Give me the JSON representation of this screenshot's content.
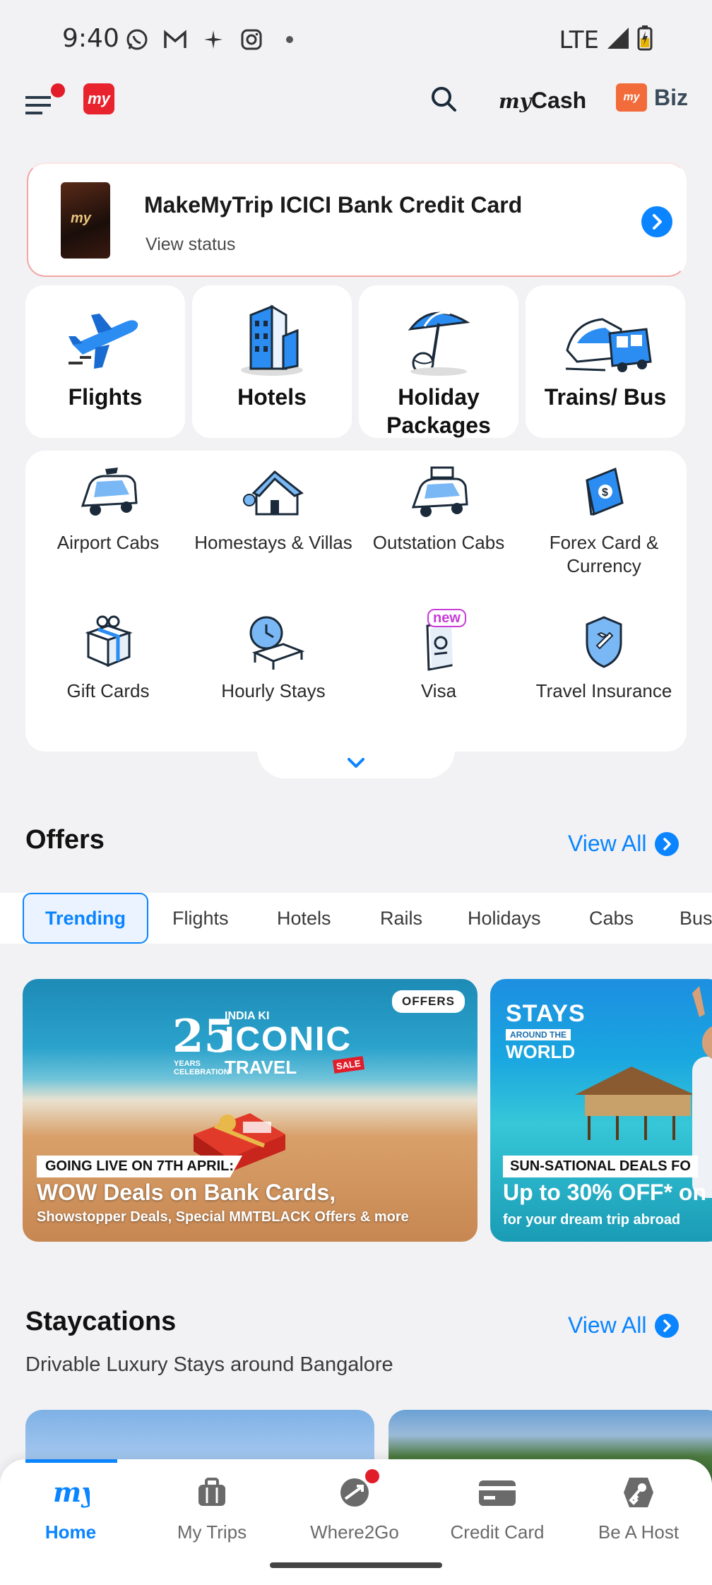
{
  "status_bar": {
    "time": "9:40",
    "network": "LTE"
  },
  "header": {
    "mycash_prefix": "my",
    "mycash_label": "Cash",
    "biz_label": "Biz",
    "biz_badge": "my",
    "logo": "my"
  },
  "credit_card": {
    "title": "MakeMyTrip ICICI Bank Credit Card",
    "subtitle": "View status"
  },
  "primary_tiles": [
    {
      "label": "Flights",
      "icon": "airplane-icon"
    },
    {
      "label": "Hotels",
      "icon": "hotel-building-icon"
    },
    {
      "label": "Holiday Packages",
      "icon": "beach-umbrella-icon"
    },
    {
      "label": "Trains/ Bus",
      "icon": "train-bus-icon"
    }
  ],
  "secondary_services": [
    {
      "label": "Airport Cabs",
      "icon": "airport-cab-icon"
    },
    {
      "label": "Homestays & Villas",
      "icon": "homestay-icon"
    },
    {
      "label": "Outstation Cabs",
      "icon": "outstation-cab-icon"
    },
    {
      "label": "Forex Card & Currency",
      "icon": "forex-card-icon"
    },
    {
      "label": "Gift Cards",
      "icon": "gift-card-icon"
    },
    {
      "label": "Hourly Stays",
      "icon": "hourly-stay-icon"
    },
    {
      "label": "Visa",
      "icon": "visa-passport-icon",
      "badge": "new"
    },
    {
      "label": "Travel Insurance",
      "icon": "travel-insurance-icon"
    }
  ],
  "offers": {
    "title": "Offers",
    "view_all": "View All",
    "tabs": [
      "Trending",
      "Flights",
      "Hotels",
      "Rails",
      "Holidays",
      "Cabs",
      "Bus"
    ],
    "active_tab": "Trending",
    "cards": [
      {
        "tag": "OFFERS",
        "brand_kicker": "INDIA KI",
        "brand_number": "25",
        "brand_years": "YEARS CELEBRATION",
        "brand_big": "ICONIC",
        "brand_sub": "TRAVEL",
        "brand_badge": "SALE",
        "kicker": "GOING LIVE ON 7TH APRIL:",
        "headline": "WOW Deals on Bank Cards,",
        "description": "Showstopper Deals, Special MMTBLACK Offers & more"
      },
      {
        "brand_big": "STAYS",
        "brand_small": "AROUND THE",
        "brand_world": "WORLD",
        "kicker": "SUN-SATIONAL DEALS FO",
        "headline": "Up to 30% OFF* on",
        "description": "for your dream trip abroad"
      }
    ]
  },
  "staycations": {
    "title": "Staycations",
    "view_all": "View All",
    "subtitle": "Drivable Luxury Stays around Bangalore"
  },
  "bottom_nav": [
    {
      "label": "Home",
      "icon": "home-my-icon",
      "active": true
    },
    {
      "label": "My Trips",
      "icon": "suitcase-icon"
    },
    {
      "label": "Where2Go",
      "icon": "where2go-icon",
      "dot": true
    },
    {
      "label": "Credit Card",
      "icon": "credit-card-icon"
    },
    {
      "label": "Be A Host",
      "icon": "host-key-icon"
    }
  ],
  "colors": {
    "accent": "#0a84ff",
    "brand_red": "#e8232e",
    "biz_orange": "#f26b3a"
  }
}
